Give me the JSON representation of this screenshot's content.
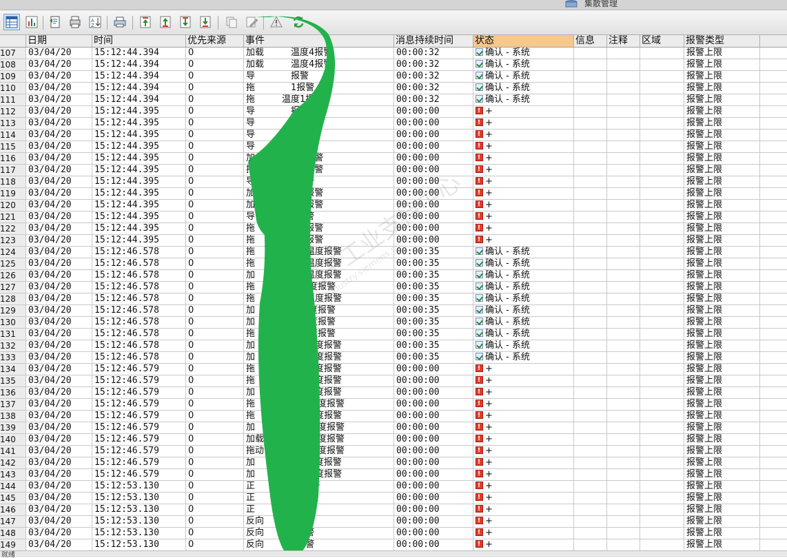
{
  "window": {
    "title": "集散管理"
  },
  "colors": {
    "header_selected": "#f6c88b",
    "alarm": "#e23b2c",
    "redaction": "#22b24c"
  },
  "toolbar": {
    "buttons": [
      {
        "name": "grid-view-icon",
        "active": true
      },
      {
        "name": "bar-chart-icon"
      },
      {
        "name": "export-icon"
      },
      {
        "name": "print-preview-icon"
      },
      {
        "name": "sort-icon"
      },
      {
        "name": "print-icon"
      },
      {
        "name": "move-top-icon"
      },
      {
        "name": "move-up-icon"
      },
      {
        "name": "move-down-icon"
      },
      {
        "name": "move-bottom-icon"
      },
      {
        "name": "copy-icon"
      },
      {
        "name": "edit-note-icon"
      },
      {
        "name": "acknowledge-icon"
      },
      {
        "name": "refresh-icon"
      }
    ]
  },
  "columns": {
    "date": "日期",
    "time": "时间",
    "priority_source": "优先来源",
    "event": "事件",
    "duration": "消息持续时间",
    "status": "状态",
    "info": "信息",
    "note": "注释",
    "area": "区域",
    "alarm_type": "报警类型"
  },
  "rows": [
    {
      "n": "107",
      "date": "03/04/20",
      "time": "15:12:44.394",
      "pri": "0",
      "event": "加载　　　温度4报警",
      "dur": "00:00:32",
      "st": "ok",
      "status": "确认 - 系统",
      "type": "报警上限"
    },
    {
      "n": "108",
      "date": "03/04/20",
      "time": "15:12:44.394",
      "pri": "0",
      "event": "加载　　　温度4报警",
      "dur": "00:00:32",
      "st": "ok",
      "status": "确认 - 系统",
      "type": "报警上限"
    },
    {
      "n": "109",
      "date": "03/04/20",
      "time": "15:12:44.394",
      "pri": "0",
      "event": "导　　　　报警",
      "dur": "00:00:32",
      "st": "ok",
      "status": "确认 - 系统",
      "type": "报警上限"
    },
    {
      "n": "110",
      "date": "03/04/20",
      "time": "15:12:44.394",
      "pri": "0",
      "event": "拖　　　　1报警",
      "dur": "00:00:32",
      "st": "ok",
      "status": "确认 - 系统",
      "type": "报警上限"
    },
    {
      "n": "111",
      "date": "03/04/20",
      "time": "15:12:44.394",
      "pri": "0",
      "event": "拖　　　温度1报警",
      "dur": "00:00:32",
      "st": "ok",
      "status": "确认 - 系统",
      "type": "报警上限"
    },
    {
      "n": "112",
      "date": "03/04/20",
      "time": "15:12:44.395",
      "pri": "0",
      "event": "导　　　　报警",
      "dur": "00:00:00",
      "st": "alarm",
      "status": "+",
      "type": "报警上限"
    },
    {
      "n": "113",
      "date": "03/04/20",
      "time": "15:12:44.395",
      "pri": "0",
      "event": "导　　　　报警",
      "dur": "00:00:00",
      "st": "alarm",
      "status": "+",
      "type": "报警上限"
    },
    {
      "n": "114",
      "date": "03/04/20",
      "time": "15:12:44.395",
      "pri": "0",
      "event": "导　　　　1报警",
      "dur": "00:00:00",
      "st": "alarm",
      "status": "+",
      "type": "报警上限"
    },
    {
      "n": "115",
      "date": "03/04/20",
      "time": "15:12:44.395",
      "pri": "0",
      "event": "导　　　　8报警",
      "dur": "00:00:00",
      "st": "alarm",
      "status": "+",
      "type": "报警上限"
    },
    {
      "n": "116",
      "date": "03/04/20",
      "time": "15:12:44.395",
      "pri": "0",
      "event": "加　　　温度4报警",
      "dur": "00:00:00",
      "st": "alarm",
      "status": "+",
      "type": "报警上限"
    },
    {
      "n": "117",
      "date": "03/04/20",
      "time": "15:12:44.395",
      "pri": "0",
      "event": "拖　　　温度1报警",
      "dur": "00:00:00",
      "st": "alarm",
      "status": "+",
      "type": "报警上限"
    },
    {
      "n": "118",
      "date": "03/04/20",
      "time": "15:12:44.395",
      "pri": "0",
      "event": "导　　　　7报警",
      "dur": "00:00:00",
      "st": "alarm",
      "status": "+",
      "type": "报警上限"
    },
    {
      "n": "119",
      "date": "03/04/20",
      "time": "15:12:44.395",
      "pri": "0",
      "event": "加　　　温度4报警",
      "dur": "00:00:00",
      "st": "alarm",
      "status": "+",
      "type": "报警上限"
    },
    {
      "n": "120",
      "date": "03/04/20",
      "time": "15:12:44.395",
      "pri": "0",
      "event": "加　　　温度4报警",
      "dur": "00:00:00",
      "st": "alarm",
      "status": "+",
      "type": "报警上限"
    },
    {
      "n": "121",
      "date": "03/04/20",
      "time": "15:12:44.395",
      "pri": "0",
      "event": "导　　　　8报警",
      "dur": "00:00:00",
      "st": "alarm",
      "status": "+",
      "type": "报警上限"
    },
    {
      "n": "122",
      "date": "03/04/20",
      "time": "15:12:44.395",
      "pri": "0",
      "event": "拖　　　温度1报警",
      "dur": "00:00:00",
      "st": "alarm",
      "status": "+",
      "type": "报警上限"
    },
    {
      "n": "123",
      "date": "03/04/20",
      "time": "15:12:44.395",
      "pri": "0",
      "event": "拖　　　温度1报警",
      "dur": "00:00:00",
      "st": "alarm",
      "status": "+",
      "type": "报警上限"
    },
    {
      "n": "124",
      "date": "03/04/20",
      "time": "15:12:46.578",
      "pri": "0",
      "event": "拖　　　组B相温度报警",
      "dur": "00:00:35",
      "st": "ok",
      "status": "确认 - 系统",
      "type": "报警上限"
    },
    {
      "n": "125",
      "date": "03/04/20",
      "time": "15:12:46.578",
      "pri": "0",
      "event": "拖　　　组A相温度报警",
      "dur": "00:00:35",
      "st": "ok",
      "status": "确认 - 系统",
      "type": "报警上限"
    },
    {
      "n": "126",
      "date": "03/04/20",
      "time": "15:12:46.578",
      "pri": "0",
      "event": "加　　　组A相温度报警",
      "dur": "00:00:35",
      "st": "ok",
      "status": "确认 - 系统",
      "type": "报警上限"
    },
    {
      "n": "127",
      "date": "03/04/20",
      "time": "15:12:46.578",
      "pri": "0",
      "event": "拖　　　轴承温度报警",
      "dur": "00:00:35",
      "st": "ok",
      "status": "确认 - 系统",
      "type": "报警上限"
    },
    {
      "n": "128",
      "date": "03/04/20",
      "time": "15:12:46.578",
      "pri": "0",
      "event": "拖　　　组C相温度报警",
      "dur": "00:00:35",
      "st": "ok",
      "status": "确认 - 系统",
      "type": "报警上限"
    },
    {
      "n": "129",
      "date": "03/04/20",
      "time": "15:12:46.578",
      "pri": "0",
      "event": "加　　　轴承温度报警",
      "dur": "00:00:35",
      "st": "ok",
      "status": "确认 - 系统",
      "type": "报警上限"
    },
    {
      "n": "130",
      "date": "03/04/20",
      "time": "15:12:46.578",
      "pri": "0",
      "event": "加　　　轴承温度报警",
      "dur": "00:00:35",
      "st": "ok",
      "status": "确认 - 系统",
      "type": "报警上限"
    },
    {
      "n": "131",
      "date": "03/04/20",
      "time": "15:12:46.578",
      "pri": "0",
      "event": "拖　　　轴承温度报警",
      "dur": "00:00:35",
      "st": "ok",
      "status": "确认 - 系统",
      "type": "报警上限"
    },
    {
      "n": "132",
      "date": "03/04/20",
      "time": "15:12:46.578",
      "pri": "0",
      "event": "加　　　组B相温度报警",
      "dur": "00:00:35",
      "st": "ok",
      "status": "确认 - 系统",
      "type": "报警上限"
    },
    {
      "n": "133",
      "date": "03/04/20",
      "time": "15:12:46.578",
      "pri": "0",
      "event": "加　　　组C相温度报警",
      "dur": "00:00:35",
      "st": "ok",
      "status": "确认 - 系统",
      "type": "报警上限"
    },
    {
      "n": "134",
      "date": "03/04/20",
      "time": "15:12:46.579",
      "pri": "0",
      "event": "拖　　　组B相温度报警",
      "dur": "00:00:00",
      "st": "alarm",
      "status": "+",
      "type": "报警上限"
    },
    {
      "n": "135",
      "date": "03/04/20",
      "time": "15:12:46.579",
      "pri": "0",
      "event": "拖　　　组A相温度报警",
      "dur": "00:00:00",
      "st": "alarm",
      "status": "+",
      "type": "报警上限"
    },
    {
      "n": "136",
      "date": "03/04/20",
      "time": "15:12:46.579",
      "pri": "0",
      "event": "加　　　组A相温度报警",
      "dur": "00:00:00",
      "st": "alarm",
      "status": "+",
      "type": "报警上限"
    },
    {
      "n": "137",
      "date": "03/04/20",
      "time": "15:12:46.579",
      "pri": "0",
      "event": "拖　　　左轴承温度报警",
      "dur": "00:00:00",
      "st": "alarm",
      "status": "+",
      "type": "报警上限"
    },
    {
      "n": "138",
      "date": "03/04/20",
      "time": "15:12:46.579",
      "pri": "0",
      "event": "拖　　　组C相温度报警",
      "dur": "00:00:00",
      "st": "alarm",
      "status": "+",
      "type": "报警上限"
    },
    {
      "n": "139",
      "date": "03/04/20",
      "time": "15:12:46.579",
      "pri": "0",
      "event": "加　　　右轴承温度报警",
      "dur": "00:00:00",
      "st": "alarm",
      "status": "+",
      "type": "报警上限"
    },
    {
      "n": "140",
      "date": "03/04/20",
      "time": "15:12:46.579",
      "pri": "0",
      "event": "加载　　右轴承温度报警",
      "dur": "00:00:00",
      "st": "alarm",
      "status": "+",
      "type": "报警上限"
    },
    {
      "n": "141",
      "date": "03/04/20",
      "time": "15:12:46.579",
      "pri": "0",
      "event": "拖动　　右轴承温度报警",
      "dur": "00:00:00",
      "st": "alarm",
      "status": "+",
      "type": "报警上限"
    },
    {
      "n": "142",
      "date": "03/04/20",
      "time": "15:12:46.579",
      "pri": "0",
      "event": "加　　　组B相温度报警",
      "dur": "00:00:00",
      "st": "alarm",
      "status": "+",
      "type": "报警上限"
    },
    {
      "n": "143",
      "date": "03/04/20",
      "time": "15:12:46.579",
      "pri": "0",
      "event": "加　　　组C相温度报警",
      "dur": "00:00:00",
      "st": "alarm",
      "status": "+",
      "type": "报警上限"
    },
    {
      "n": "144",
      "date": "03/04/20",
      "time": "15:12:53.130",
      "pri": "0",
      "event": "正　　　　13报警",
      "dur": "00:00:00",
      "st": "alarm",
      "status": "+",
      "type": "报警上限"
    },
    {
      "n": "145",
      "date": "03/04/20",
      "time": "15:12:53.130",
      "pri": "0",
      "event": "正　　　　1报警",
      "dur": "00:00:00",
      "st": "alarm",
      "status": "+",
      "type": "报警上限"
    },
    {
      "n": "146",
      "date": "03/04/20",
      "time": "15:12:53.130",
      "pri": "0",
      "event": "正　　　　2报警",
      "dur": "00:00:00",
      "st": "alarm",
      "status": "+",
      "type": "报警上限"
    },
    {
      "n": "147",
      "date": "03/04/20",
      "time": "15:12:53.130",
      "pri": "0",
      "event": "反向　　　4报警",
      "dur": "00:00:00",
      "st": "alarm",
      "status": "+",
      "type": "报警上限"
    },
    {
      "n": "148",
      "date": "03/04/20",
      "time": "15:12:53.130",
      "pri": "0",
      "event": "反向　　　5报警",
      "dur": "00:00:00",
      "st": "alarm",
      "status": "+",
      "type": "报警上限"
    },
    {
      "n": "149",
      "date": "03/04/20",
      "time": "15:12:53.130",
      "pri": "0",
      "event": "反向　　力6报警",
      "dur": "00:00:00",
      "st": "alarm",
      "status": "+",
      "type": "报警上限"
    }
  ],
  "watermark": {
    "text": "西门子工业支持中心",
    "url": "support.industry.siemens.com/cs"
  },
  "status_bar": {
    "text": "就绪"
  }
}
